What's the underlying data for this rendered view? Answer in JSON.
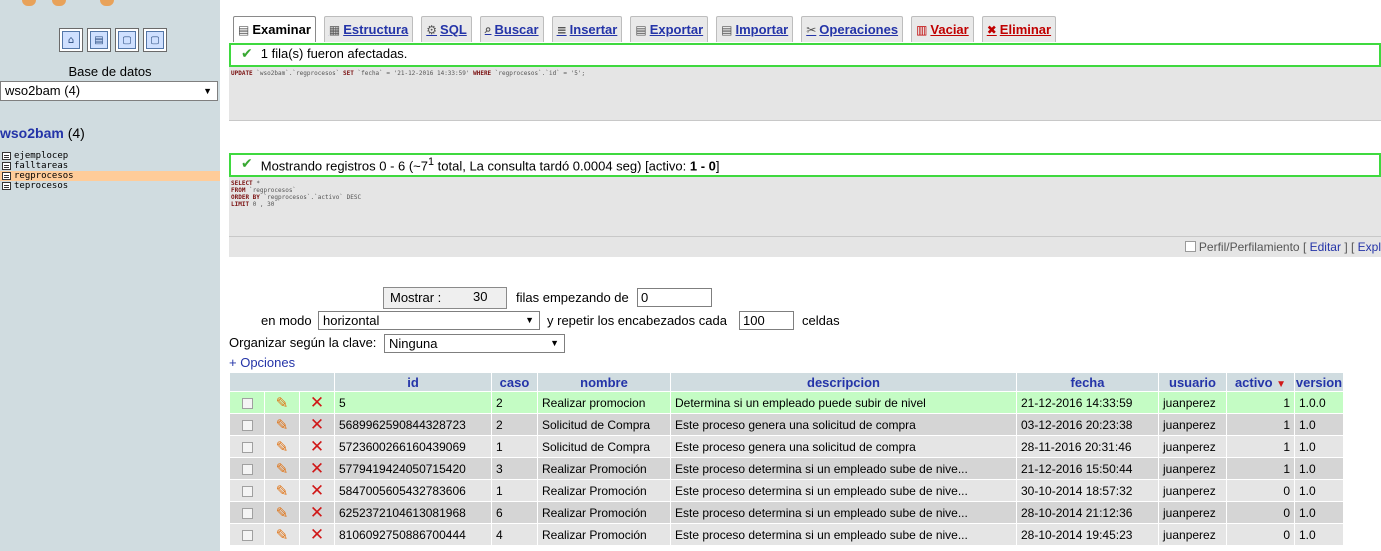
{
  "nav": {
    "db_label": "Base de datos",
    "db_select": "wso2bam (4)",
    "db_name": "wso2bam",
    "db_count": "(4)",
    "tables": [
      "ejemplocep",
      "falltareas",
      "regprocesos",
      "teprocesos"
    ],
    "active_table": "regprocesos"
  },
  "tabs": [
    {
      "label": "Examinar",
      "icon": "browse-icon"
    },
    {
      "label": "Estructura",
      "icon": "structure-icon"
    },
    {
      "label": "SQL",
      "icon": "sql-icon"
    },
    {
      "label": "Buscar",
      "icon": "search-icon"
    },
    {
      "label": "Insertar",
      "icon": "insert-icon"
    },
    {
      "label": "Exportar",
      "icon": "export-icon"
    },
    {
      "label": "Importar",
      "icon": "import-icon"
    },
    {
      "label": "Operaciones",
      "icon": "operations-icon"
    },
    {
      "label": "Vaciar",
      "icon": "empty-icon"
    },
    {
      "label": "Eliminar",
      "icon": "drop-icon"
    }
  ],
  "messages": {
    "affected": "1 fila(s) fueron afectadas.",
    "update_sql_kw1": "UPDATE",
    "update_sql_1": "`wso2bam`.`regprocesos`",
    "update_sql_kw2": "SET",
    "update_sql_2": "`fecha` = '21-12-2016 14:33:59'",
    "update_sql_kw3": "WHERE",
    "update_sql_3": "`regprocesos`.`id` = '5';",
    "showing_prefix": "Mostrando registros 0 - 6 (~7",
    "showing_sup": "1",
    "showing_suffix": " total, La consulta tardó 0.0004 seg) [activo: ",
    "showing_bold": "1 - 0",
    "showing_end": "]",
    "select_lines": [
      {
        "kw": "SELECT",
        "rest": "*"
      },
      {
        "kw": "FROM",
        "rest": "`regprocesos`"
      },
      {
        "kw": "ORDER BY",
        "rest": "`regprocesos`.`activo` DESC"
      },
      {
        "kw": "LIMIT",
        "rest": "0 , 30"
      }
    ],
    "profiling_label": "Perfil/Perfilamiento",
    "edit_link": "Editar",
    "explain_link": "Expl"
  },
  "controls": {
    "show_button": "Mostrar :",
    "show_count": "30",
    "rows_from_label": "filas empezando de",
    "rows_from_value": "0",
    "mode_label": "en modo",
    "mode_value": "horizontal",
    "repeat_label": "y repetir los encabezados cada",
    "repeat_value": "100",
    "cells_label": "celdas",
    "sort_label": "Organizar según la clave:",
    "sort_value": "Ninguna",
    "options_link": "+ Opciones"
  },
  "table": {
    "columns": [
      "id",
      "caso",
      "nombre",
      "descripcion",
      "fecha",
      "usuario",
      "activo",
      "version"
    ],
    "rows": [
      [
        "5",
        "2",
        "Realizar promocion",
        "Determina si un empleado puede subir de nivel",
        "21-12-2016 14:33:59",
        "juanperez",
        "1",
        "1.0.0"
      ],
      [
        "5689962590844328723",
        "2",
        "Solicitud de Compra",
        "Este proceso genera una solicitud de compra",
        "03-12-2016 20:23:38",
        "juanperez",
        "1",
        "1.0"
      ],
      [
        "5723600266160439069",
        "1",
        "Solicitud de Compra",
        "Este proceso genera una solicitud de compra",
        "28-11-2016 20:31:46",
        "juanperez",
        "1",
        "1.0"
      ],
      [
        "5779419424050715420",
        "3",
        "Realizar Promoción",
        "Este proceso determina si un empleado sube de nive...",
        "21-12-2016 15:50:44",
        "juanperez",
        "1",
        "1.0"
      ],
      [
        "5847005605432783606",
        "1",
        "Realizar Promoción",
        "Este proceso determina si un empleado sube de nive...",
        "30-10-2014 18:57:32",
        "juanperez",
        "0",
        "1.0"
      ],
      [
        "6252372104613081968",
        "6",
        "Realizar Promoción",
        "Este proceso determina si un empleado sube de nive...",
        "28-10-2014 21:12:36",
        "juanperez",
        "0",
        "1.0"
      ],
      [
        "8106092750886700444",
        "4",
        "Realizar Promoción",
        "Este proceso determina si un empleado sube de nive...",
        "28-10-2014 19:45:23",
        "juanperez",
        "0",
        "1.0"
      ]
    ]
  }
}
